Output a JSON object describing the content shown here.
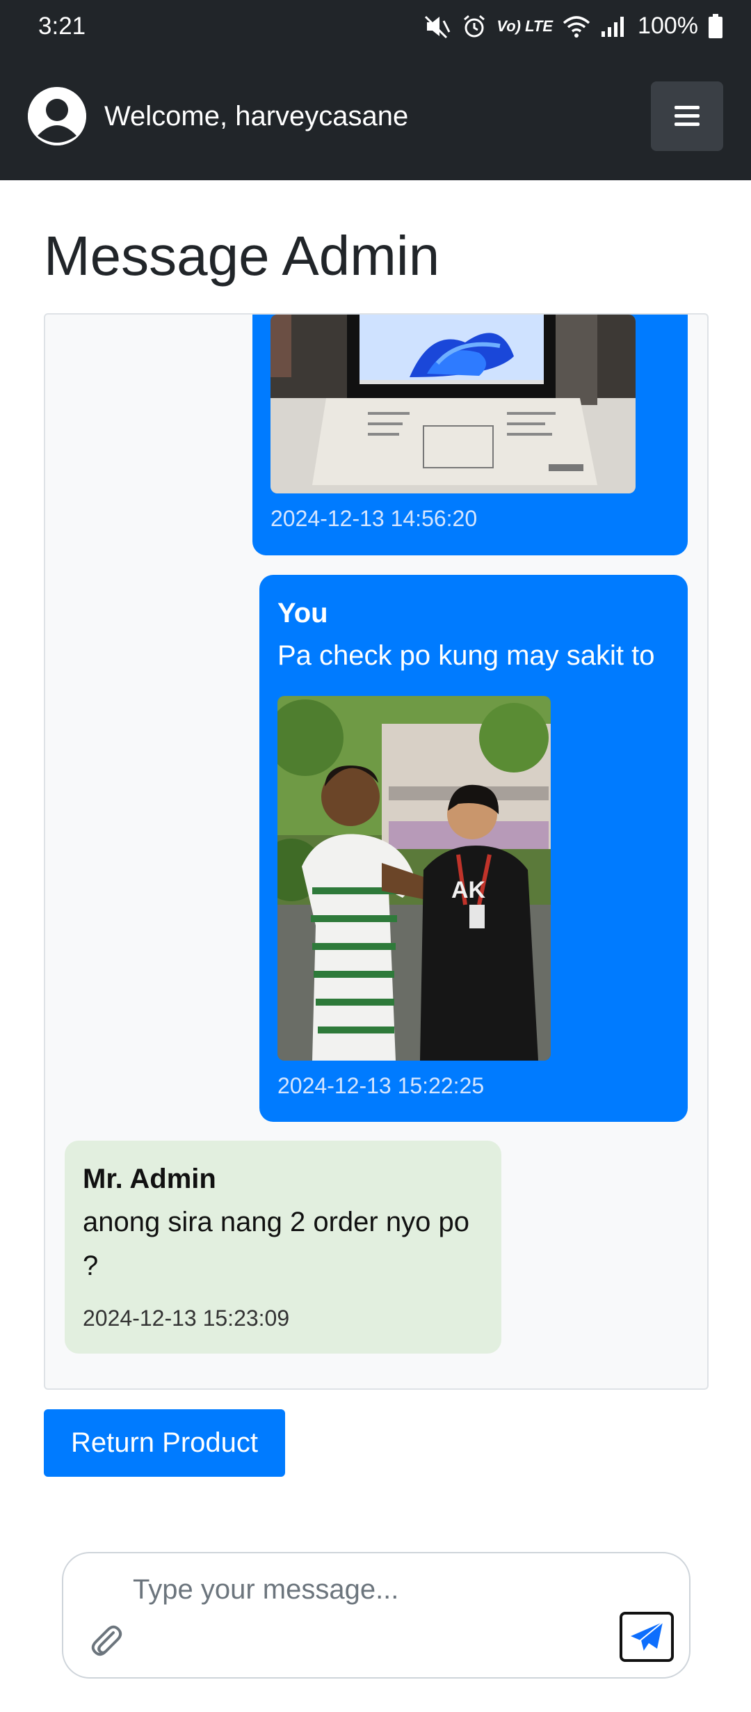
{
  "status_bar": {
    "time": "3:21",
    "volte": "Vo) LTE",
    "battery": "100%",
    "icons": [
      "mute-icon",
      "alarm-icon",
      "volte-icon",
      "wifi-icon",
      "signal-icon",
      "battery-icon"
    ]
  },
  "navbar": {
    "welcome": "Welcome, harveycasane",
    "menu_icon": "hamburger-icon"
  },
  "page": {
    "title": "Message Admin"
  },
  "messages": [
    {
      "sender": "",
      "text": "",
      "image": "laptop-photo",
      "timestamp": "2024-12-13 14:56:20",
      "from": "user"
    },
    {
      "sender": "You",
      "text": "Pa check po kung may sakit to",
      "image": "people-photo",
      "timestamp": "2024-12-13 15:22:25",
      "from": "user"
    },
    {
      "sender": "Mr. Admin",
      "text_line1": "anong sira nang 2 order nyo po",
      "text_line2": "?",
      "timestamp": "2024-12-13 15:23:09",
      "from": "admin"
    }
  ],
  "actions": {
    "return_product": "Return Product"
  },
  "composer": {
    "placeholder": "Type your message...",
    "attach_icon": "paperclip-icon",
    "send_icon": "paper-plane-icon"
  },
  "colors": {
    "header_bg": "#212529",
    "user_bubble": "#007bff",
    "admin_bubble": "#e2efdf",
    "primary_button": "#007bff"
  }
}
